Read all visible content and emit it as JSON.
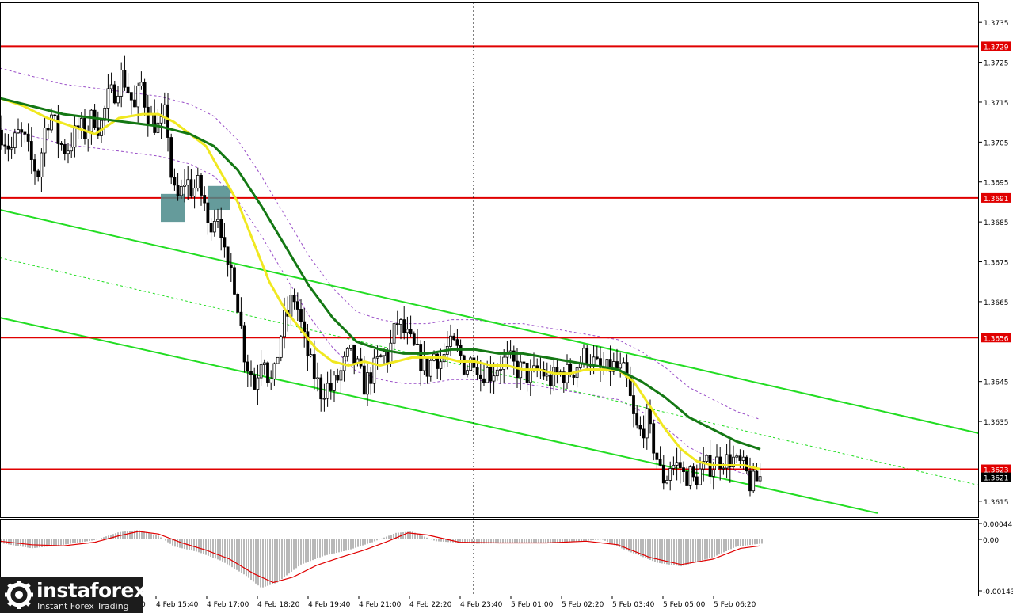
{
  "chart_data": [
    {
      "type": "candlestick",
      "symbol_levels": [
        1.3729,
        1.3691,
        1.3656,
        1.3623
      ],
      "last_price": 1.3621,
      "y_ticks": [
        "1.3735",
        "1.3725",
        "1.3715",
        "1.3705",
        "1.3695",
        "1.3685",
        "1.3675",
        "1.3665",
        "1.3645",
        "1.3635",
        "1.3615"
      ],
      "ylim": [
        1.3611,
        1.374
      ],
      "x_labels": [
        "4 Feb 15:40",
        "4 Feb 17:00",
        "4 Feb 18:20",
        "4 Feb 19:40",
        "4 Feb 21:00",
        "4 Feb 22:20",
        "4 Feb 23:40",
        "5 Feb 01:00",
        "5 Feb 02:20",
        "5 Feb 03:40",
        "5 Feb 05:00",
        "5 Feb 06:20"
      ],
      "x_label_clipped": "0",
      "close_path": [
        [
          0,
          1.3708
        ],
        [
          14,
          1.3703
        ],
        [
          22,
          1.3707
        ],
        [
          30,
          1.3706
        ],
        [
          40,
          1.37
        ],
        [
          48,
          1.3697
        ],
        [
          58,
          1.371
        ],
        [
          66,
          1.3712
        ],
        [
          74,
          1.3705
        ],
        [
          84,
          1.3703
        ],
        [
          92,
          1.3706
        ],
        [
          100,
          1.3709
        ],
        [
          108,
          1.3707
        ],
        [
          118,
          1.3712
        ],
        [
          126,
          1.3708
        ],
        [
          136,
          1.3716
        ],
        [
          146,
          1.3718
        ],
        [
          154,
          1.3722
        ],
        [
          162,
          1.3718
        ],
        [
          170,
          1.3713
        ],
        [
          178,
          1.372
        ],
        [
          186,
          1.3712
        ],
        [
          194,
          1.371
        ],
        [
          202,
          1.3708
        ],
        [
          210,
          1.3713
        ],
        [
          216,
          1.3697
        ],
        [
          222,
          1.369
        ],
        [
          228,
          1.3692
        ],
        [
          234,
          1.3696
        ],
        [
          242,
          1.3693
        ],
        [
          250,
          1.3694
        ],
        [
          258,
          1.369
        ],
        [
          262,
          1.3683
        ],
        [
          268,
          1.3686
        ],
        [
          274,
          1.3688
        ],
        [
          280,
          1.3683
        ],
        [
          286,
          1.3671
        ],
        [
          292,
          1.3673
        ],
        [
          298,
          1.3668
        ],
        [
          304,
          1.3659
        ],
        [
          310,
          1.365
        ],
        [
          316,
          1.3648
        ],
        [
          322,
          1.3643
        ],
        [
          328,
          1.3651
        ],
        [
          334,
          1.3652
        ],
        [
          340,
          1.3644
        ],
        [
          346,
          1.3646
        ],
        [
          352,
          1.3654
        ],
        [
          358,
          1.366
        ],
        [
          364,
          1.3662
        ],
        [
          370,
          1.3667
        ],
        [
          376,
          1.3663
        ],
        [
          382,
          1.3657
        ],
        [
          388,
          1.3652
        ],
        [
          394,
          1.3648
        ],
        [
          400,
          1.3645
        ],
        [
          406,
          1.3642
        ],
        [
          412,
          1.3644
        ],
        [
          418,
          1.3643
        ],
        [
          424,
          1.3645
        ],
        [
          430,
          1.3647
        ],
        [
          436,
          1.365
        ],
        [
          442,
          1.3652
        ],
        [
          448,
          1.365
        ],
        [
          454,
          1.3647
        ],
        [
          460,
          1.3644
        ],
        [
          466,
          1.3646
        ],
        [
          472,
          1.3648
        ],
        [
          478,
          1.365
        ],
        [
          484,
          1.3652
        ],
        [
          490,
          1.3651
        ],
        [
          496,
          1.3656
        ],
        [
          502,
          1.366
        ],
        [
          508,
          1.3658
        ],
        [
          514,
          1.3656
        ],
        [
          520,
          1.3654
        ],
        [
          526,
          1.3652
        ],
        [
          532,
          1.365
        ],
        [
          540,
          1.3648
        ],
        [
          548,
          1.3652
        ],
        [
          556,
          1.365
        ],
        [
          564,
          1.3653
        ],
        [
          572,
          1.3654
        ],
        [
          580,
          1.3652
        ],
        [
          588,
          1.3648
        ],
        [
          594,
          1.365
        ],
        [
          600,
          1.3652
        ],
        [
          606,
          1.3646
        ],
        [
          612,
          1.3648
        ],
        [
          620,
          1.3647
        ],
        [
          628,
          1.3649
        ],
        [
          636,
          1.365
        ],
        [
          644,
          1.365
        ],
        [
          652,
          1.3648
        ],
        [
          660,
          1.3648
        ],
        [
          668,
          1.3646
        ],
        [
          676,
          1.3647
        ],
        [
          684,
          1.3648
        ],
        [
          692,
          1.3645
        ],
        [
          700,
          1.3646
        ],
        [
          708,
          1.3647
        ],
        [
          716,
          1.3647
        ],
        [
          724,
          1.3648
        ],
        [
          732,
          1.365
        ],
        [
          740,
          1.3652
        ],
        [
          748,
          1.365
        ],
        [
          756,
          1.3648
        ],
        [
          764,
          1.3647
        ],
        [
          772,
          1.3649
        ],
        [
          780,
          1.3648
        ],
        [
          788,
          1.3647
        ],
        [
          794,
          1.3643
        ],
        [
          798,
          1.3637
        ],
        [
          804,
          1.3633
        ],
        [
          810,
          1.3632
        ],
        [
          816,
          1.3636
        ],
        [
          822,
          1.3631
        ],
        [
          828,
          1.3627
        ],
        [
          834,
          1.3622
        ],
        [
          840,
          1.362
        ],
        [
          846,
          1.3624
        ],
        [
          852,
          1.3624
        ],
        [
          858,
          1.3624
        ],
        [
          864,
          1.3621
        ],
        [
          870,
          1.3622
        ],
        [
          876,
          1.362
        ],
        [
          882,
          1.3622
        ],
        [
          888,
          1.3623
        ],
        [
          894,
          1.3624
        ],
        [
          900,
          1.3624
        ],
        [
          906,
          1.3625
        ],
        [
          912,
          1.3626
        ],
        [
          918,
          1.3625
        ],
        [
          924,
          1.3626
        ],
        [
          930,
          1.3624
        ],
        [
          936,
          1.3624
        ],
        [
          942,
          1.3622
        ],
        [
          948,
          1.3619
        ],
        [
          954,
          1.362
        ],
        [
          960,
          1.3621
        ]
      ],
      "ma_slow": [
        [
          0,
          1.3716
        ],
        [
          40,
          1.3714
        ],
        [
          80,
          1.3712
        ],
        [
          120,
          1.3711
        ],
        [
          160,
          1.371
        ],
        [
          200,
          1.3709
        ],
        [
          240,
          1.3707
        ],
        [
          270,
          1.3704
        ],
        [
          300,
          1.3698
        ],
        [
          330,
          1.3689
        ],
        [
          360,
          1.3679
        ],
        [
          390,
          1.3669
        ],
        [
          420,
          1.3661
        ],
        [
          450,
          1.3655
        ],
        [
          480,
          1.3653
        ],
        [
          510,
          1.3652
        ],
        [
          540,
          1.3652
        ],
        [
          570,
          1.3653
        ],
        [
          600,
          1.3653
        ],
        [
          630,
          1.3652
        ],
        [
          660,
          1.3652
        ],
        [
          690,
          1.3651
        ],
        [
          720,
          1.365
        ],
        [
          750,
          1.3649
        ],
        [
          780,
          1.3648
        ],
        [
          810,
          1.3645
        ],
        [
          840,
          1.3641
        ],
        [
          870,
          1.3636
        ],
        [
          900,
          1.3633
        ],
        [
          930,
          1.363
        ],
        [
          960,
          1.3628
        ]
      ],
      "ma_fast": [
        [
          0,
          1.3716
        ],
        [
          30,
          1.3714
        ],
        [
          60,
          1.3711
        ],
        [
          90,
          1.3709
        ],
        [
          120,
          1.3707
        ],
        [
          150,
          1.3711
        ],
        [
          180,
          1.3712
        ],
        [
          200,
          1.3712
        ],
        [
          220,
          1.371
        ],
        [
          240,
          1.3707
        ],
        [
          260,
          1.3704
        ],
        [
          280,
          1.3697
        ],
        [
          300,
          1.369
        ],
        [
          320,
          1.368
        ],
        [
          340,
          1.367
        ],
        [
          360,
          1.3663
        ],
        [
          380,
          1.3658
        ],
        [
          400,
          1.3653
        ],
        [
          420,
          1.365
        ],
        [
          440,
          1.3649
        ],
        [
          460,
          1.365
        ],
        [
          480,
          1.3649
        ],
        [
          500,
          1.365
        ],
        [
          520,
          1.3651
        ],
        [
          540,
          1.3651
        ],
        [
          560,
          1.3651
        ],
        [
          580,
          1.365
        ],
        [
          600,
          1.365
        ],
        [
          620,
          1.3649
        ],
        [
          640,
          1.3649
        ],
        [
          660,
          1.3648
        ],
        [
          680,
          1.3648
        ],
        [
          700,
          1.3647
        ],
        [
          720,
          1.3647
        ],
        [
          740,
          1.3648
        ],
        [
          760,
          1.3648
        ],
        [
          780,
          1.3648
        ],
        [
          800,
          1.3645
        ],
        [
          820,
          1.3639
        ],
        [
          840,
          1.3633
        ],
        [
          860,
          1.3628
        ],
        [
          880,
          1.3625
        ],
        [
          900,
          1.3624
        ],
        [
          920,
          1.3624
        ],
        [
          940,
          1.3624
        ],
        [
          960,
          1.3623
        ]
      ],
      "band_width": 0.00075,
      "channel_lines": [
        {
          "name": "upper",
          "p1": [
            0,
            1.3688
          ],
          "p2": [
            1236,
            1.3632
          ]
        },
        {
          "name": "lower",
          "p1": [
            0,
            1.3661
          ],
          "p2": [
            1108,
            1.3612
          ]
        },
        {
          "name": "mid",
          "p1": [
            0,
            1.3676
          ],
          "p2": [
            1236,
            1.3619
          ],
          "dashed": true
        }
      ],
      "highlight_boxes": [
        {
          "x_from": 203,
          "x_to": 234,
          "y_from": 1.3692,
          "y_to": 1.3685
        },
        {
          "x_from": 263,
          "x_to": 290,
          "y_from": 1.3694,
          "y_to": 1.3688
        }
      ],
      "colors": {
        "level": "#e00000",
        "channel": "#22dd22",
        "ma_fast": "#f0e820",
        "ma_slow": "#147814",
        "band": "#9a4fc8",
        "box": "#4a8a8a"
      }
    },
    {
      "type": "histogram",
      "y_ticks": [
        "0.00044",
        "0.00",
        "-0.00143"
      ],
      "ylim": [
        -0.00143,
        0.00044
      ],
      "bars": [
        [
          0,
          -0.0001
        ],
        [
          40,
          -0.00025
        ],
        [
          80,
          -0.00015
        ],
        [
          120,
          -2e-05
        ],
        [
          150,
          0.0002
        ],
        [
          175,
          0.00026
        ],
        [
          200,
          0.0001
        ],
        [
          220,
          -0.0002
        ],
        [
          250,
          -0.00035
        ],
        [
          280,
          -0.0006
        ],
        [
          310,
          -0.001
        ],
        [
          330,
          -0.00135
        ],
        [
          350,
          -0.0012
        ],
        [
          380,
          -0.0007
        ],
        [
          410,
          -0.00045
        ],
        [
          440,
          -0.0003
        ],
        [
          470,
          -8e-05
        ],
        [
          500,
          0.00018
        ],
        [
          520,
          0.00022
        ],
        [
          550,
          -5e-05
        ],
        [
          600,
          -0.00012
        ],
        [
          660,
          -0.0001
        ],
        [
          720,
          -8e-05
        ],
        [
          760,
          0.0
        ],
        [
          790,
          -0.0003
        ],
        [
          830,
          -0.00065
        ],
        [
          860,
          -0.00075
        ],
        [
          900,
          -0.0005
        ],
        [
          930,
          -0.0002
        ],
        [
          960,
          -0.00012
        ]
      ],
      "signal": [
        [
          0,
          -5e-05
        ],
        [
          40,
          -0.00015
        ],
        [
          80,
          -0.00018
        ],
        [
          120,
          -8e-05
        ],
        [
          150,
          0.0001
        ],
        [
          175,
          0.00022
        ],
        [
          200,
          0.00015
        ],
        [
          230,
          -0.0001
        ],
        [
          260,
          -0.0003
        ],
        [
          290,
          -0.00055
        ],
        [
          320,
          -0.00095
        ],
        [
          345,
          -0.0012
        ],
        [
          370,
          -0.00105
        ],
        [
          400,
          -0.00072
        ],
        [
          430,
          -0.0005
        ],
        [
          460,
          -0.0003
        ],
        [
          490,
          -5e-05
        ],
        [
          515,
          0.00018
        ],
        [
          540,
          0.00012
        ],
        [
          580,
          -8e-05
        ],
        [
          630,
          -0.0001
        ],
        [
          690,
          -0.0001
        ],
        [
          740,
          -5e-05
        ],
        [
          780,
          -0.00015
        ],
        [
          820,
          -0.0005
        ],
        [
          860,
          -0.0007
        ],
        [
          900,
          -0.00055
        ],
        [
          935,
          -0.00025
        ],
        [
          960,
          -0.00018
        ]
      ],
      "colors": {
        "bars": "#b8b8b8",
        "signal": "#e00000"
      }
    }
  ],
  "logo": {
    "name": "instaforex",
    "tagline": "Instant Forex Trading"
  }
}
